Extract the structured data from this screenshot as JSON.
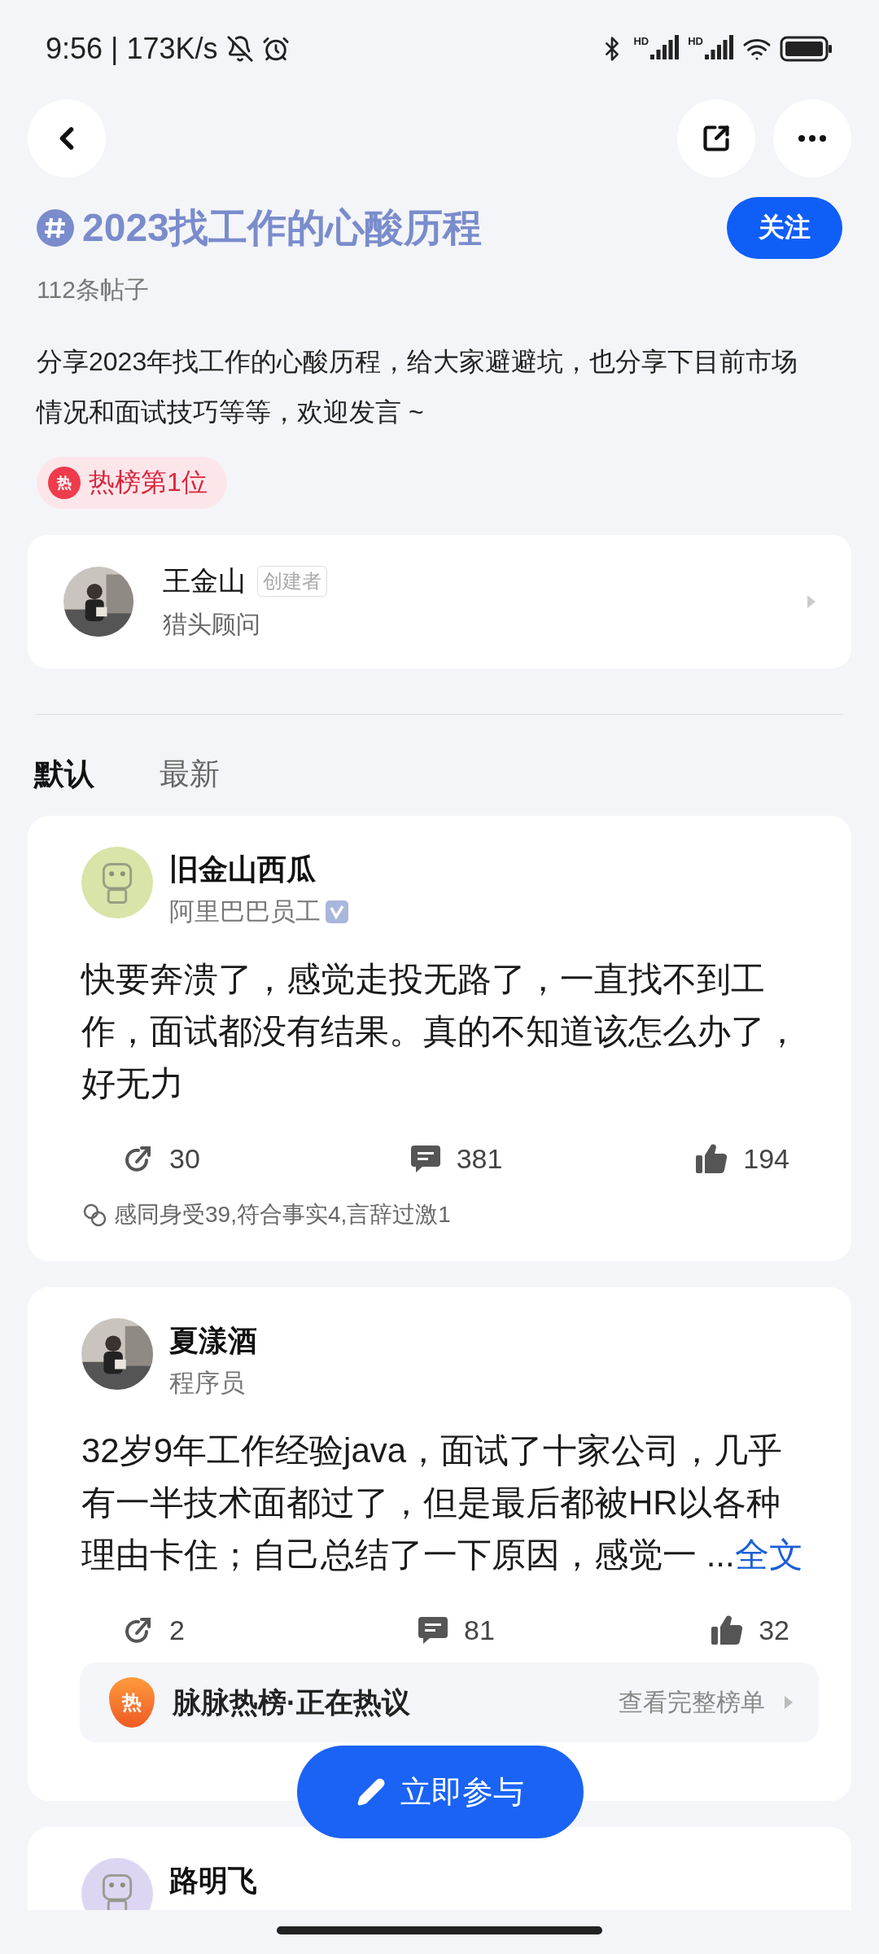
{
  "status_bar": {
    "time": "9:56 | 173K/s",
    "signal_labels": [
      "HD",
      "HD"
    ]
  },
  "topic": {
    "title": "2023找工作的心酸历程",
    "follow_label": "关注",
    "post_count": "112条帖子",
    "description": "分享2023年找工作的心酸历程，给大家避避坑，也分享下目前市场情况和面试技巧等等，欢迎发言 ~",
    "hot_icon_label": "热",
    "hot_badge": "热榜第1位"
  },
  "creator": {
    "name": "王金山",
    "badge": "创建者",
    "role": "猎头顾问"
  },
  "tabs": [
    {
      "label": "默认",
      "selected": true
    },
    {
      "label": "最新",
      "selected": false
    }
  ],
  "posts": [
    {
      "author": "旧金山西瓜",
      "role": "阿里巴巴员工",
      "verified": true,
      "avatar": {
        "kind": "icon",
        "color": "#d8e4a8"
      },
      "body": "快要奔溃了，感觉走投无路了，一直找不到工作，面试都没有结果。真的不知道该怎么办了，好无力",
      "shares": "30",
      "comments": "381",
      "likes": "194",
      "reactions": "感同身受39,符合事实4,言辞过激1"
    },
    {
      "author": "夏漾酒",
      "role": "程序员",
      "body": "32岁9年工作经验java，面试了十家公司，几乎有一半技术面都过了，但是最后都被HR以各种理由卡住；自己总结了一下原因，感觉一 ...",
      "more_link": "全文",
      "shares": "2",
      "comments": "81",
      "likes": "32",
      "hot_strip": {
        "icon_label": "热",
        "title": "脉脉热榜·正在热议",
        "link": "查看完整榜单"
      }
    },
    {
      "author": "路明飞",
      "avatar": {
        "kind": "icon",
        "color": "#ddd6f3"
      }
    }
  ],
  "join_button": "立即参与"
}
